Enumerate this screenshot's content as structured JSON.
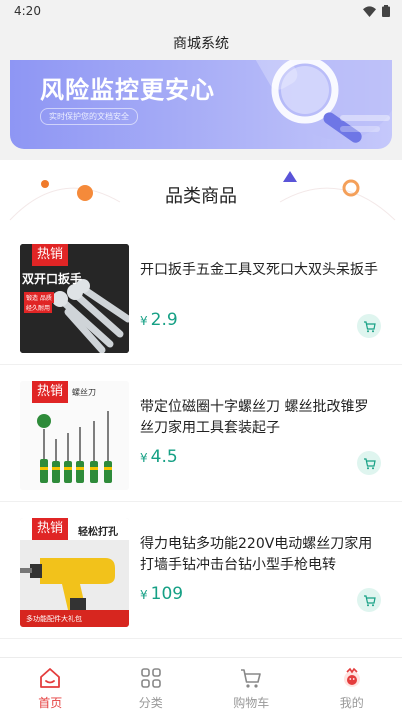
{
  "status_bar": {
    "time": "4:20"
  },
  "header": {
    "title": "商城系统"
  },
  "banner": {
    "title": "风险监控更安心",
    "subtitle": "实时保护您的文档安全"
  },
  "section": {
    "title": "品类商品"
  },
  "products": [
    {
      "tag": "热销",
      "name": "开口扳手五金工具叉死口大双头呆扳手",
      "currency": "¥",
      "price": "2.9",
      "image_text": [
        "双开口扳手",
        "锻造 品质",
        "经久耐用"
      ]
    },
    {
      "tag": "热销",
      "name": "带定位磁圈十字螺丝刀 螺丝批改锥罗丝刀家用工具套装起子",
      "currency": "¥",
      "price": "4.5",
      "image_text": [
        "螺丝刀"
      ]
    },
    {
      "tag": "热销",
      "name": "得力电钻多功能220V电动螺丝刀家用打墙手钻冲击台钻小型手枪电转",
      "currency": "¥",
      "price": "109",
      "image_text": [
        "轻松打孔",
        "多功能配件大礼包"
      ]
    }
  ],
  "tabs": [
    {
      "label": "首页",
      "icon": "home-icon",
      "active": true
    },
    {
      "label": "分类",
      "icon": "grid-icon",
      "active": false
    },
    {
      "label": "购物车",
      "icon": "cart-icon",
      "active": false
    },
    {
      "label": "我的",
      "icon": "profile-icon",
      "active": false
    }
  ],
  "colors": {
    "accent": "#e43d3d",
    "price": "#16a085",
    "tag": "#e02525",
    "banner": "#8e96f4"
  }
}
